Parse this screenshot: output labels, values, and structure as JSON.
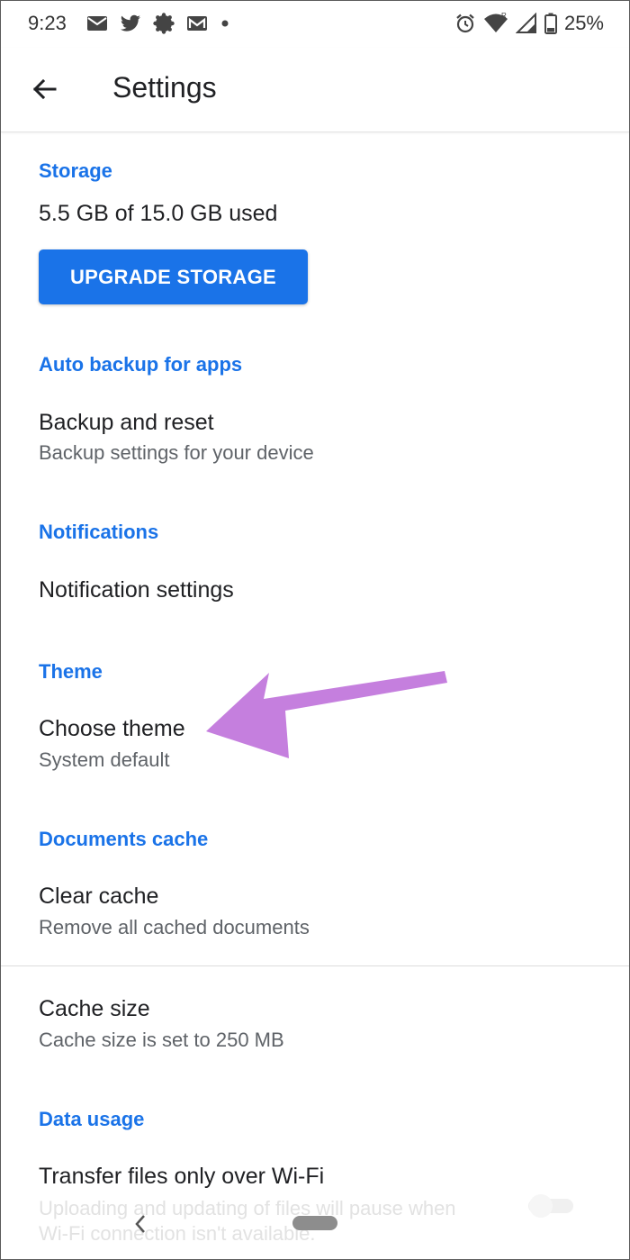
{
  "status_bar": {
    "time": "9:23",
    "left_icons": [
      "mail-icon",
      "twitter-icon",
      "gear-badge-icon",
      "gmail-icon",
      "dot-icon"
    ],
    "right_icons": [
      "alarm-icon",
      "wifi-icon",
      "signal-roaming-icon",
      "battery-icon"
    ],
    "battery": "25%"
  },
  "app_bar": {
    "title": "Settings",
    "back_icon": "arrow-back-icon"
  },
  "sections": {
    "storage": {
      "header": "Storage",
      "usage": "5.5 GB of 15.0 GB used",
      "button_label": "UPGRADE STORAGE"
    },
    "backup": {
      "header": "Auto backup for apps",
      "title": "Backup and reset",
      "subtitle": "Backup settings for your device"
    },
    "notifications": {
      "header": "Notifications",
      "title": "Notification settings"
    },
    "theme": {
      "header": "Theme",
      "title": "Choose theme",
      "subtitle": "System default"
    },
    "documents_cache": {
      "header": "Documents cache",
      "clear_title": "Clear cache",
      "clear_subtitle": "Remove all cached documents",
      "size_title": "Cache size",
      "size_subtitle": "Cache size is set to 250 MB"
    },
    "data_usage": {
      "header": "Data usage",
      "title": "Transfer files only over Wi-Fi",
      "subtitle_line1": "Uploading and updating of files will pause when",
      "subtitle_line2": "Wi-Fi connection isn't available."
    }
  },
  "colors": {
    "accent": "#1a73e8",
    "annotation_arrow": "#c57fde"
  }
}
